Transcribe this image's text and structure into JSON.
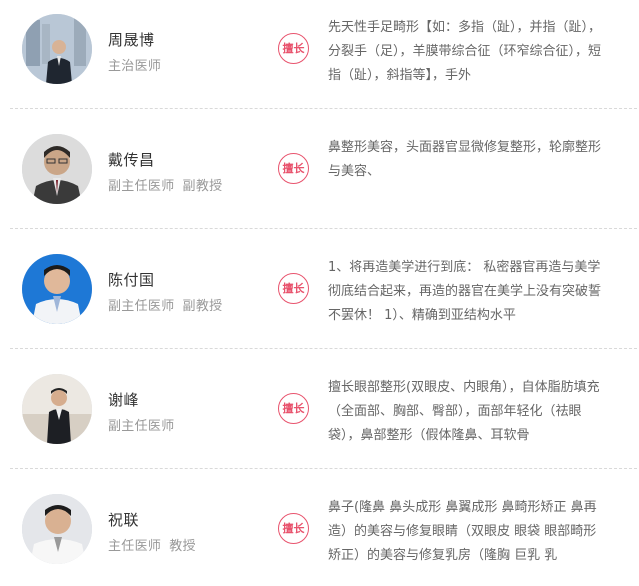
{
  "badge_label": "擅长",
  "colors": {
    "accent": "#e8536d",
    "name": "#333333",
    "title": "#999999",
    "desc": "#666666",
    "divider": "#d9d9d9"
  },
  "doctors": [
    {
      "name": "周晟博",
      "titles": [
        "主治医师"
      ],
      "specialty": "先天性手足畸形【如：多指（趾），并指（趾），分裂手（足），羊膜带综合征（环窄综合征），短指（趾），斜指等】，手外"
    },
    {
      "name": "戴传昌",
      "titles": [
        "副主任医师",
        "副教授"
      ],
      "specialty": "鼻整形美容，头面器官显微修复整形，轮廓整形与美容、"
    },
    {
      "name": "陈付国",
      "titles": [
        "副主任医师",
        "副教授"
      ],
      "specialty": "1、将再造美学进行到底： 私密器官再造与美学彻底结合起来，再造的器官在美学上没有突破誓不罢休！ 1）、精确到亚结构水平"
    },
    {
      "name": "谢峰",
      "titles": [
        "副主任医师"
      ],
      "specialty": "擅长眼部整形(双眼皮、内眼角），自体脂肪填充（全面部、胸部、臀部），面部年轻化（祛眼袋），鼻部整形（假体隆鼻、耳软骨"
    },
    {
      "name": "祝联",
      "titles": [
        "主任医师",
        "教授"
      ],
      "specialty": "鼻子(隆鼻 鼻头成形 鼻翼成形 鼻畸形矫正 鼻再造）的美容与修复眼睛（双眼皮 眼袋 眼部畸形矫正）的美容与修复乳房（隆胸 巨乳 乳"
    }
  ]
}
